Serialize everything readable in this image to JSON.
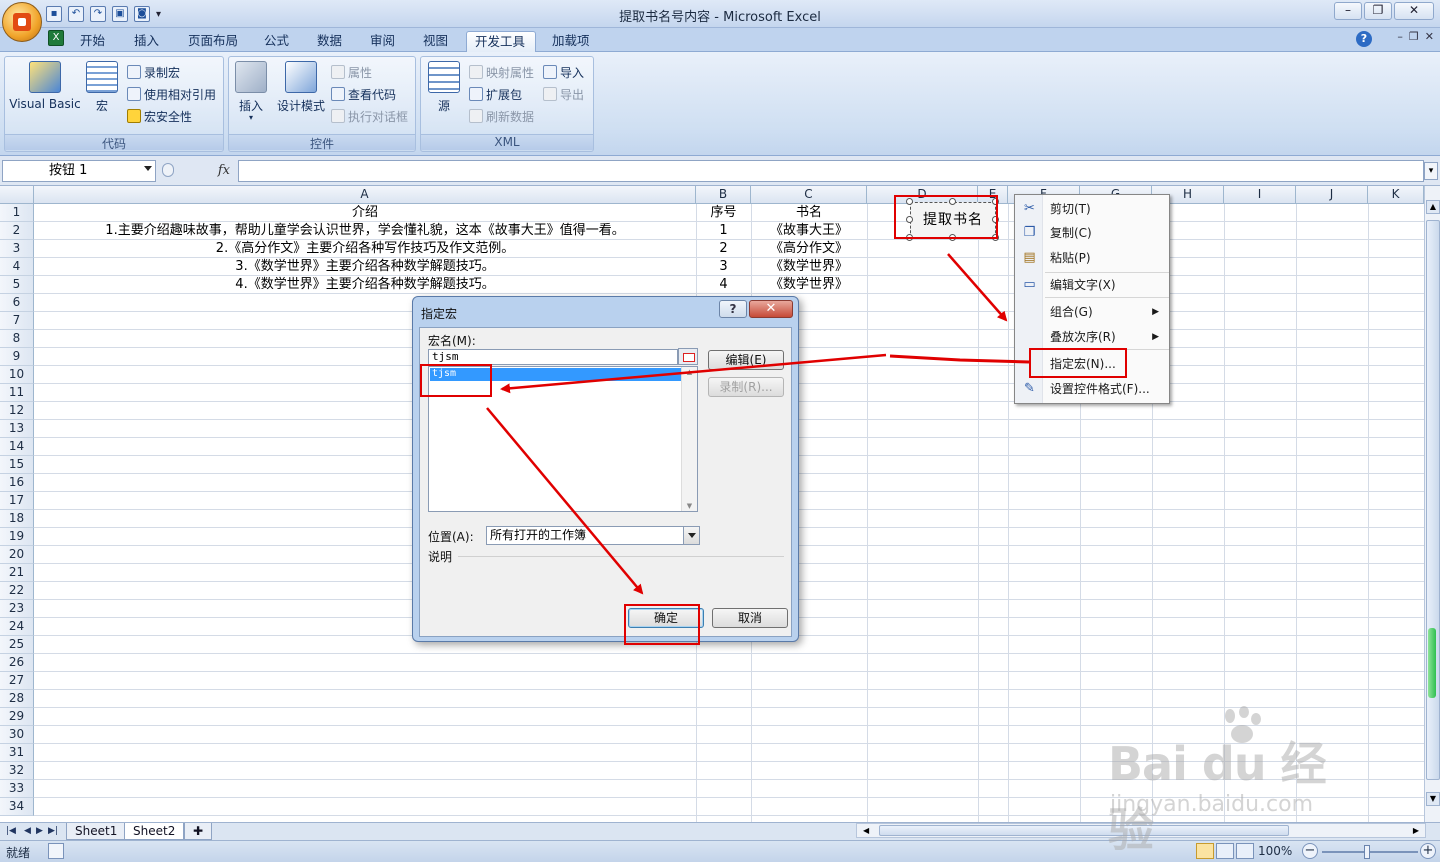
{
  "window": {
    "title": "提取书名号内容 - Microsoft Excel"
  },
  "ribbon": {
    "tabs": [
      "开始",
      "插入",
      "页面布局",
      "公式",
      "数据",
      "审阅",
      "视图",
      "开发工具",
      "加载项"
    ],
    "active_tab": "开发工具",
    "groups": {
      "code": {
        "label": "代码",
        "visual_basic": "Visual Basic",
        "macros": "宏",
        "record_macro": "录制宏",
        "relative_ref": "使用相对引用",
        "macro_security": "宏安全性"
      },
      "controls": {
        "label": "控件",
        "insert": "插入",
        "design_mode": "设计模式",
        "properties": "属性",
        "view_code": "查看代码",
        "run_dialog": "执行对话框"
      },
      "xml": {
        "label": "XML",
        "source": "源",
        "map_properties": "映射属性",
        "expansion_packs": "扩展包",
        "refresh_data": "刷新数据",
        "import": "导入",
        "export": "导出"
      }
    }
  },
  "formula_bar": {
    "name_box": "按钮 1",
    "fx": "fx",
    "formula": ""
  },
  "sheet": {
    "columns": [
      "A",
      "B",
      "C",
      "D",
      "E",
      "F",
      "G",
      "H",
      "I",
      "J",
      "K"
    ],
    "rows": [
      "1",
      "2",
      "3",
      "4",
      "5",
      "6",
      "7",
      "8",
      "9",
      "10",
      "11",
      "12",
      "13",
      "14",
      "15",
      "16",
      "17",
      "18",
      "19",
      "20",
      "21",
      "22",
      "23",
      "24",
      "25",
      "26",
      "27",
      "28",
      "29",
      "30",
      "31",
      "32",
      "33",
      "34"
    ],
    "cells": {
      "A1": "介绍",
      "B1": "序号",
      "C1": "书名",
      "A2": "1.主要介绍趣味故事，帮助儿童学会认识世界，学会懂礼貌，这本《故事大王》值得一看。",
      "B2": "1",
      "C2": "《故事大王》",
      "A3": "2.《高分作文》主要介绍各种写作技巧及作文范例。",
      "B3": "2",
      "C3": "《高分作文》",
      "A4": "3.《数学世界》主要介绍各种数学解题技巧。",
      "B4": "3",
      "C4": "《数学世界》",
      "A5": "4.《数学世界》主要介绍各种数学解题技巧。",
      "B5": "4",
      "C5": "《数学世界》"
    },
    "form_button_label": "提取书名"
  },
  "context_menu": {
    "items": [
      {
        "label": "剪切(T)",
        "icon": "scissors-icon"
      },
      {
        "label": "复制(C)",
        "icon": "copy-icon"
      },
      {
        "label": "粘贴(P)",
        "icon": "paste-icon"
      },
      {
        "label": "编辑文字(X)",
        "icon": "edit-text-icon"
      },
      {
        "label": "组合(G)",
        "icon": "",
        "submenu": true
      },
      {
        "label": "叠放次序(R)",
        "icon": "",
        "submenu": true
      },
      {
        "label": "指定宏(N)...",
        "icon": ""
      },
      {
        "label": "设置控件格式(F)...",
        "icon": "format-control-icon"
      }
    ]
  },
  "dialog": {
    "title": "指定宏",
    "help": "?",
    "close": "✕",
    "macro_name_label": "宏名(M):",
    "macro_name_value": "tjsm",
    "macro_list": [
      "tjsm"
    ],
    "edit_button": "编辑(E)",
    "record_button": "录制(R)...",
    "location_label": "位置(A):",
    "location_value": "所有打开的工作簿",
    "description_label": "说明",
    "ok_button": "确定",
    "cancel_button": "取消"
  },
  "sheet_tabs": [
    "Sheet1",
    "Sheet2"
  ],
  "active_sheet": "Sheet2",
  "status": {
    "text": "就绪",
    "zoom": "100%"
  },
  "watermark": {
    "logo": "Bai du 经验",
    "url": "jingyan.baidu.com"
  },
  "colors": {
    "annotation_red": "#e00000",
    "selection_blue": "#3399ff",
    "ribbon_blue": "#cfdff2"
  }
}
